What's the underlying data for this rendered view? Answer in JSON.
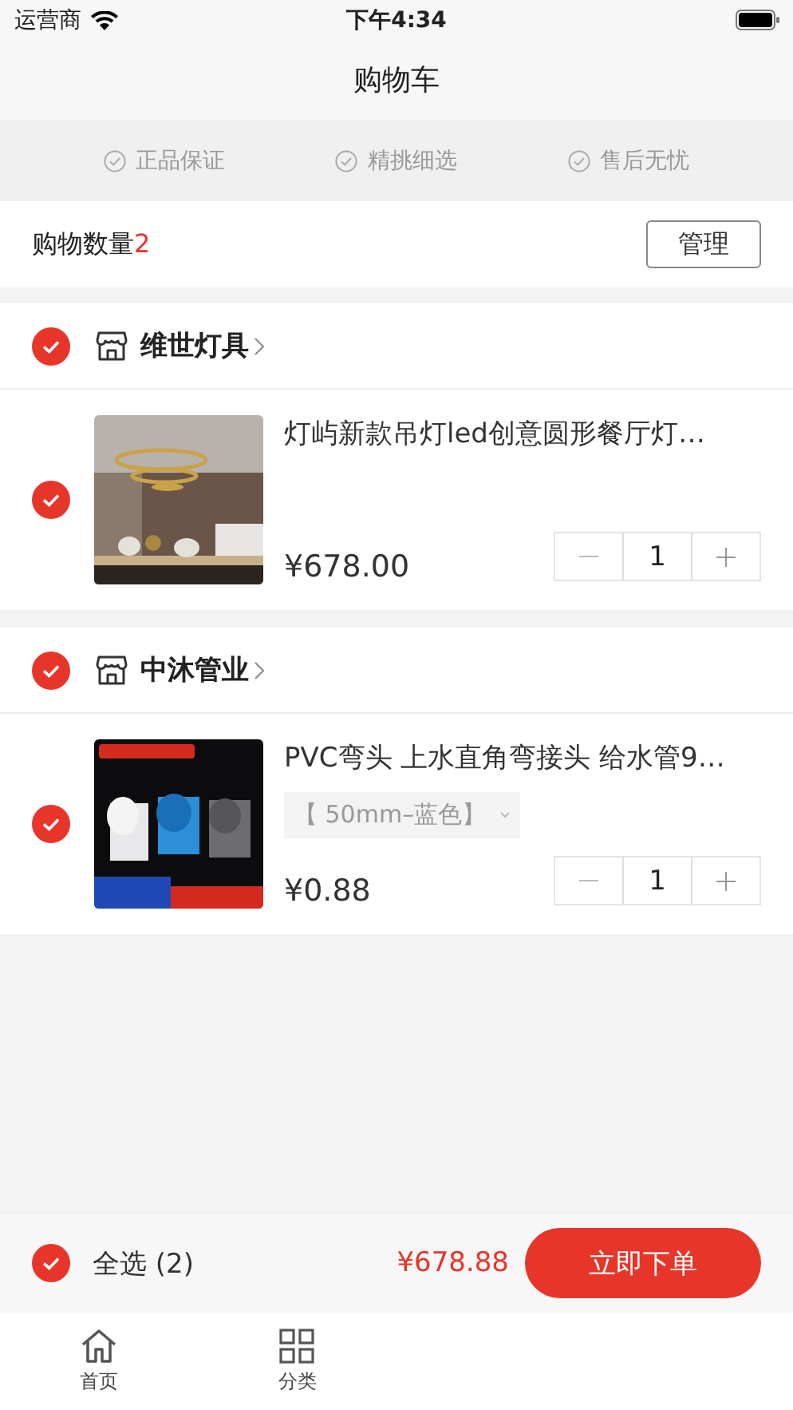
{
  "status_bar": {
    "carrier": "运营商",
    "time": "下午4:34"
  },
  "nav": {
    "title": "购物车"
  },
  "guarantees": [
    "正品保证",
    "精挑细选",
    "售后无忧"
  ],
  "summary": {
    "label": "购物数量",
    "count": "2",
    "manage_button": "管理"
  },
  "stores": [
    {
      "name": "维世灯具",
      "checked": true,
      "items": [
        {
          "title": "灯屿新款吊灯led创意圆形餐厅灯…",
          "price": "¥678.00",
          "quantity": "1",
          "checked": true
        }
      ]
    },
    {
      "name": "中沐管业",
      "checked": true,
      "items": [
        {
          "title": "PVC弯头 上水直角弯接头 给水管9…",
          "spec": "【 50mm–蓝色】",
          "price": "¥0.88",
          "quantity": "1",
          "checked": true
        }
      ]
    }
  ],
  "footer": {
    "select_all": "全选 (2)",
    "checked": true,
    "total": "¥678.88",
    "order_button": "立即下单"
  },
  "tab_bar": [
    {
      "label": "首页"
    },
    {
      "label": "分类"
    }
  ]
}
